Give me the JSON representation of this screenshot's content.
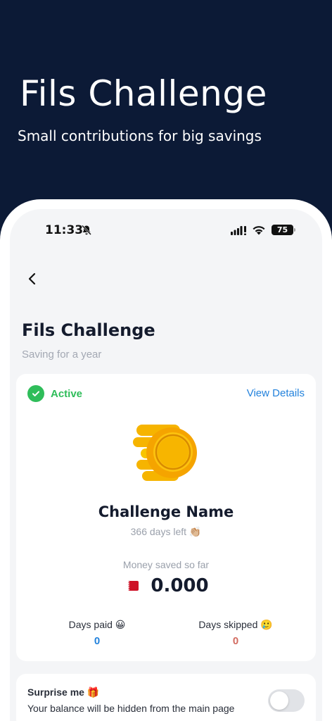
{
  "hero": {
    "title": "Fils Challenge",
    "subtitle": "Small contributions for big savings"
  },
  "status_bar": {
    "time": "11:33",
    "battery": "75"
  },
  "page": {
    "title": "Fils Challenge",
    "subtitle": "Saving for a year"
  },
  "challenge_card": {
    "status": "Active",
    "view_details": "View Details",
    "name": "Challenge Name",
    "days_left": "366 days left 👏🏼",
    "money_label": "Money saved so far",
    "money_amount": "0.000",
    "days_paid_label": "Days paid 😀",
    "days_paid_value": "0",
    "days_skipped_label": "Days skipped 🥲",
    "days_skipped_value": "0"
  },
  "surprise_card": {
    "title": "Surprise me 🎁",
    "subtitle": "Your balance will be hidden from the main page",
    "toggle_on": false
  },
  "colors": {
    "background": "#0c1a36",
    "active_green": "#2fbd5a",
    "link_blue": "#2382dc",
    "skipped_red": "#d26b60",
    "coin_gold": "#f6b400"
  },
  "icons": [
    "bell-slash-icon",
    "signal-icon",
    "wifi-icon",
    "battery-icon",
    "back-chevron-icon",
    "check-circle-icon",
    "coin-icon",
    "bahrain-flag-icon",
    "toggle-switch"
  ]
}
